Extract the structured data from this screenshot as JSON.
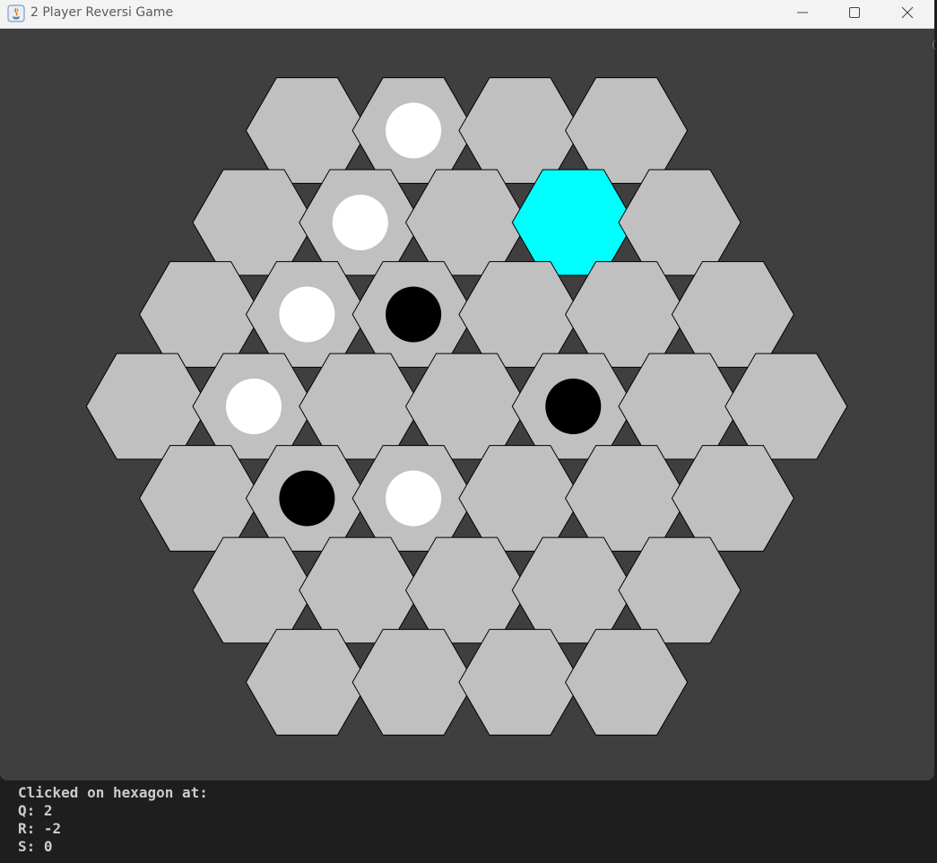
{
  "window": {
    "title": "2 Player Reversi Game",
    "controls": {
      "minimize_icon": "minimize-icon",
      "maximize_icon": "maximize-icon",
      "close_icon": "close-icon"
    },
    "app_icon": "java-icon"
  },
  "colors": {
    "window_bg": "#3f3f3f",
    "hex_fill": "#c0c0c0",
    "hex_selected": "#00ffff",
    "hex_stroke": "#000000",
    "piece_white": "#ffffff",
    "piece_black": "#000000",
    "console_bg": "#1e1e1e",
    "console_text": "#cccccc"
  },
  "board": {
    "radius": 3,
    "selected": {
      "q": 2,
      "r": -2
    },
    "pieces": [
      {
        "q": 1,
        "r": -3,
        "color": "white"
      },
      {
        "q": 0,
        "r": -2,
        "color": "white"
      },
      {
        "q": -1,
        "r": -1,
        "color": "white"
      },
      {
        "q": 0,
        "r": -1,
        "color": "black"
      },
      {
        "q": -2,
        "r": 0,
        "color": "white"
      },
      {
        "q": 1,
        "r": 0,
        "color": "black"
      },
      {
        "q": -2,
        "r": 1,
        "color": "black"
      },
      {
        "q": -1,
        "r": 1,
        "color": "white"
      }
    ]
  },
  "console": {
    "heading": "Clicked on hexagon at:",
    "q_line": "Q: 2",
    "r_line": "R: -2",
    "s_line": "S: 0"
  }
}
